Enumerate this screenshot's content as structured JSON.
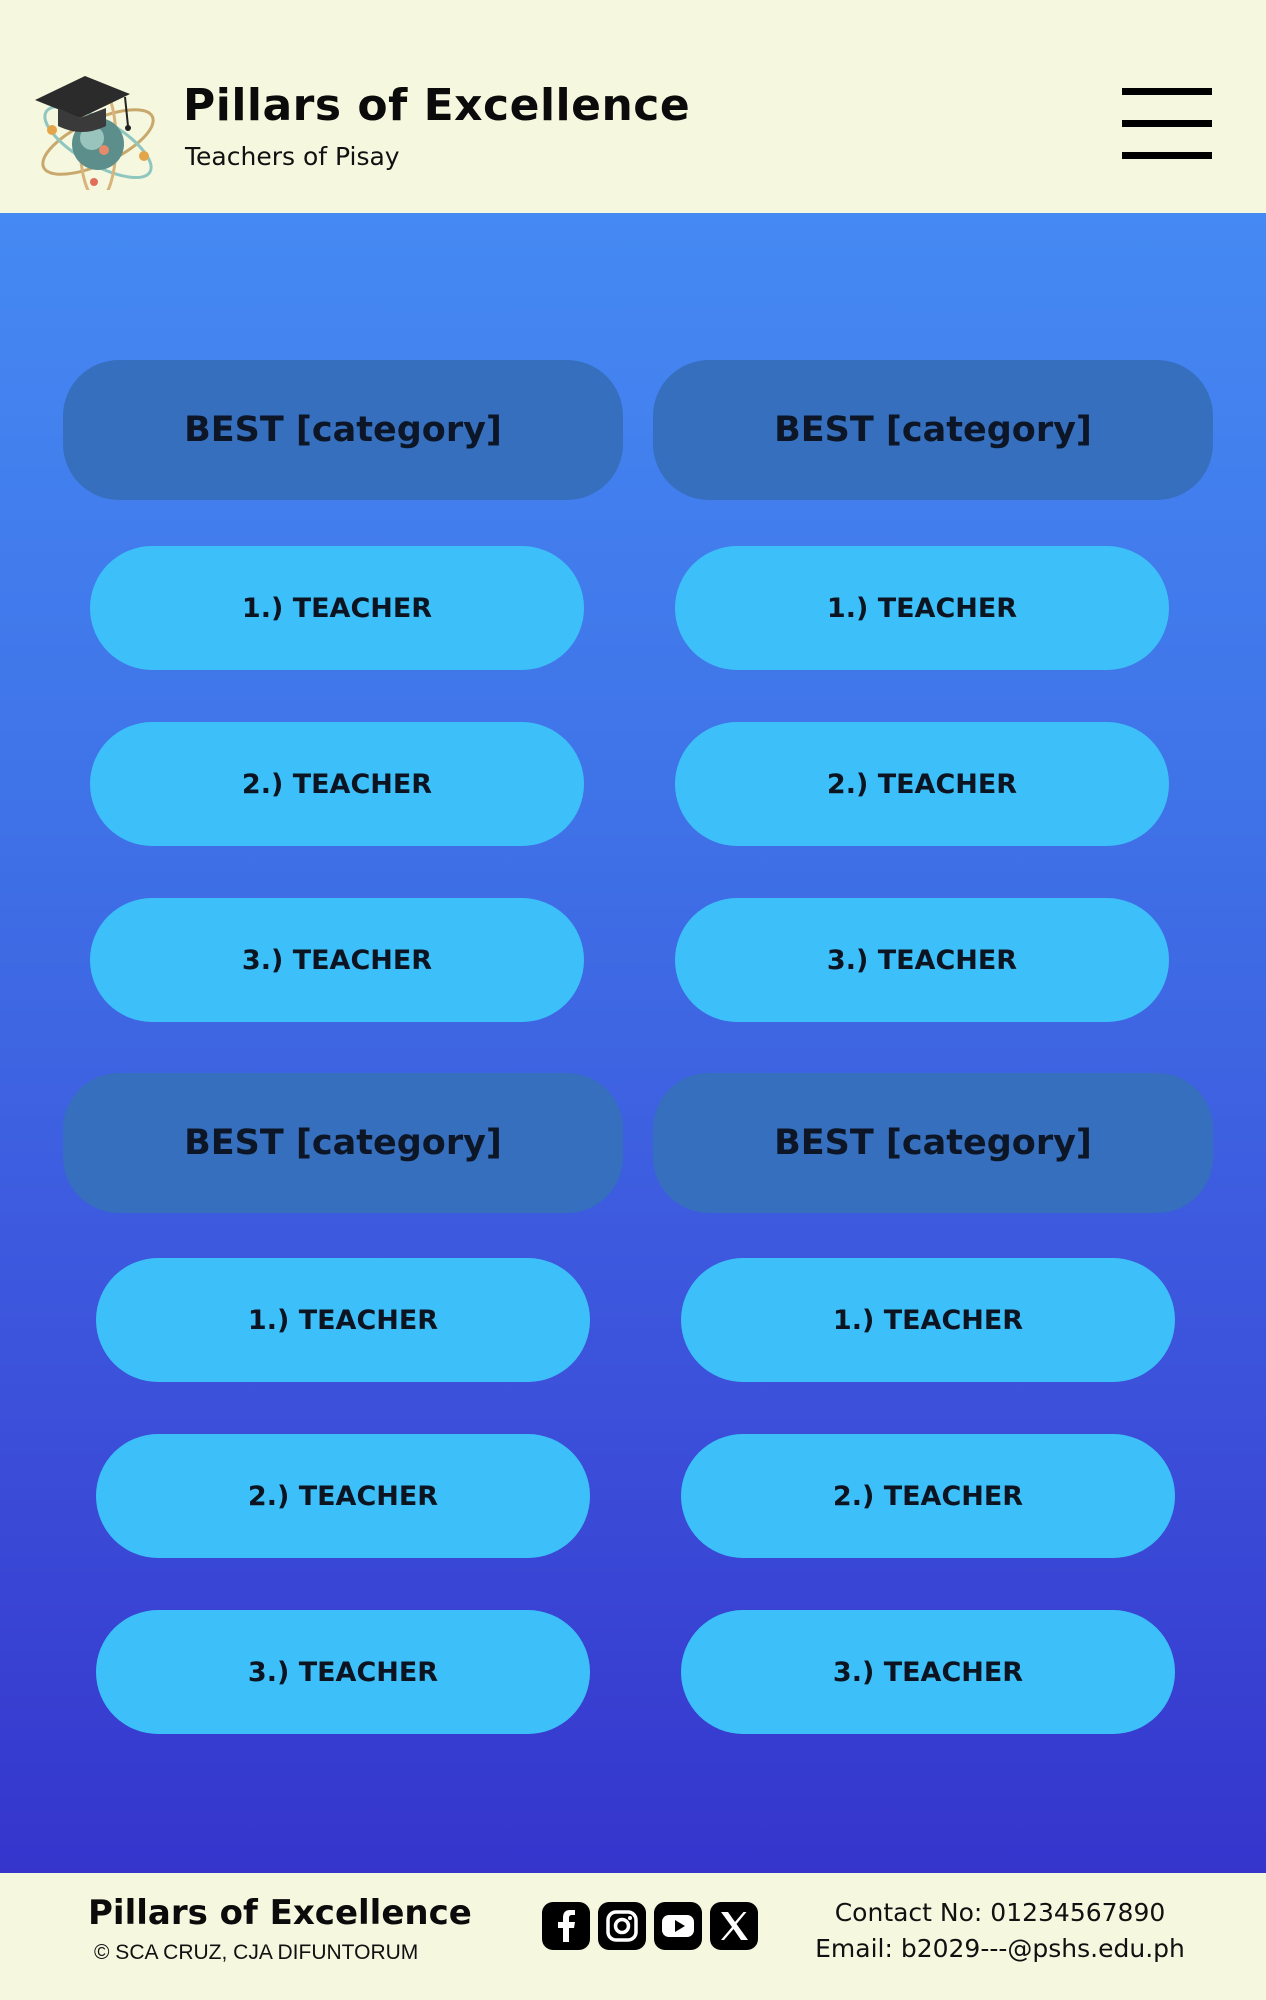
{
  "header": {
    "title": "Pillars of Excellence",
    "subtitle": "Teachers of Pisay",
    "logo_icon": "graduation-cap-atom-logo",
    "menu_icon": "hamburger-menu-icon"
  },
  "categories": [
    {
      "label": "BEST [category]",
      "teachers": [
        "1.) TEACHER",
        "2.) TEACHER",
        "3.) TEACHER"
      ]
    },
    {
      "label": "BEST [category]",
      "teachers": [
        "1.) TEACHER",
        "2.) TEACHER",
        "3.) TEACHER"
      ]
    },
    {
      "label": "BEST [category]",
      "teachers": [
        "1.) TEACHER",
        "2.) TEACHER",
        "3.) TEACHER"
      ]
    },
    {
      "label": "BEST [category]",
      "teachers": [
        "1.) TEACHER",
        "2.) TEACHER",
        "3.) TEACHER"
      ]
    }
  ],
  "footer": {
    "title": "Pillars of Excellence",
    "copyright": "© SCA CRUZ, CJA DIFUNTORUM",
    "contact": "Contact No: 01234567890",
    "email": "Email: b2029---@pshs.edu.ph",
    "social_icons": [
      "facebook-icon",
      "instagram-icon",
      "youtube-icon",
      "x-icon"
    ]
  },
  "colors": {
    "header_bg": "#f5f7df",
    "gradient_top": "#4589f3",
    "gradient_bottom": "#3535cc",
    "category_bg": "#356fbd",
    "teacher_bg": "#3dc0f9"
  }
}
